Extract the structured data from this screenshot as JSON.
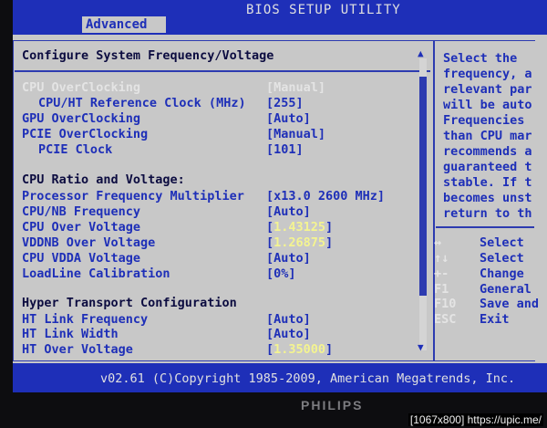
{
  "header": {
    "title": "BIOS SETUP UTILITY",
    "active_tab": "Advanced"
  },
  "page": {
    "heading": "Configure System Frequency/Voltage"
  },
  "settings": [
    {
      "label": "CPU OverClocking",
      "value": "[Manual]"
    },
    {
      "label": "CPU/HT Reference Clock (MHz)",
      "value": "[255]"
    },
    {
      "label": "GPU OverClocking",
      "value": "[Auto]"
    },
    {
      "label": "PCIE OverClocking",
      "value": "[Manual]"
    },
    {
      "label": "PCIE Clock",
      "value": "[101]"
    },
    {
      "label": "Processor Frequency Multiplier",
      "value": "[x13.0 2600 MHz]"
    },
    {
      "label": "CPU/NB Frequency",
      "value": "[Auto]"
    },
    {
      "label": "CPU Over Voltage",
      "value": "1.43125"
    },
    {
      "label": "VDDNB Over Voltage",
      "value": "1.26875"
    },
    {
      "label": "CPU VDDA Voltage",
      "value": "[Auto]"
    },
    {
      "label": "LoadLine Calibration",
      "value": "[0%]"
    },
    {
      "label": "HT Link Frequency",
      "value": "[Auto]"
    },
    {
      "label": "HT Link Width",
      "value": "[Auto]"
    },
    {
      "label": "HT Over Voltage",
      "value": "1.35000"
    }
  ],
  "sections": {
    "cpu_ratio": "CPU Ratio and Voltage:",
    "hyper_transport": "Hyper Transport Configuration"
  },
  "help": {
    "lines": [
      "Select the",
      "frequency, a",
      "relevant par",
      "will be auto",
      "Frequencies",
      "than CPU mar",
      "recommends a",
      "guaranteed t",
      "stable. If t",
      "becomes unst",
      "return to th"
    ]
  },
  "keys": [
    {
      "key": "↔",
      "desc": "Select"
    },
    {
      "key": "↑↓",
      "desc": "Select"
    },
    {
      "key": "+-",
      "desc": "Change"
    },
    {
      "key": "F1",
      "desc": "General"
    },
    {
      "key": "F10",
      "desc": "Save and"
    },
    {
      "key": "ESC",
      "desc": "Exit"
    }
  ],
  "footer": {
    "text": "v02.61 (C)Copyright 1985-2009, American Megatrends, Inc."
  },
  "monitor": {
    "brand": "PHILIPS"
  },
  "watermark": "[1067x800] https://upic.me/",
  "colors": {
    "bios_blue": "#1e2fb8",
    "bios_gray": "#c8c8c8",
    "highlight_white": "#e4e4e4",
    "value_yellow": "#f4f490"
  }
}
